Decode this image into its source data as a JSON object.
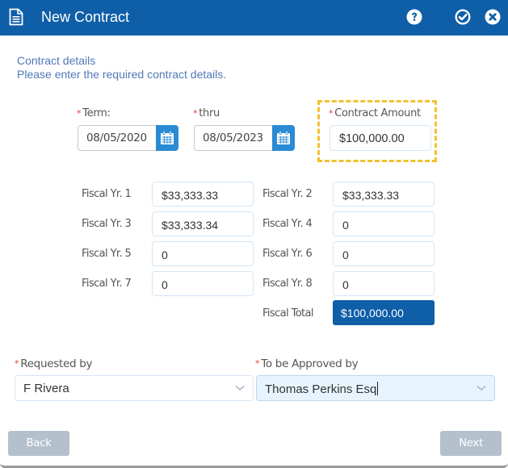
{
  "window": {
    "title": "New Contract",
    "icons": {
      "title": "document-icon",
      "help": "help-icon",
      "confirm": "check-circle-icon",
      "close": "close-circle-icon"
    }
  },
  "intro": {
    "heading": "Contract details",
    "subheading": "Please enter the required contract details."
  },
  "term": {
    "required_mark": "*",
    "start_label": "Term:",
    "start_value": "08/05/2020",
    "end_label": "thru",
    "end_value": "08/05/2023",
    "calendar_icon": "calendar-icon"
  },
  "contract_amount": {
    "required_mark": "*",
    "label": "Contract Amount",
    "value": "$100,000.00"
  },
  "fiscal_years": [
    {
      "label": "Fiscal Yr. 1",
      "value": "$33,333.33"
    },
    {
      "label": "Fiscal Yr. 2",
      "value": "$33,333.33"
    },
    {
      "label": "Fiscal Yr. 3",
      "value": "$33,333.34"
    },
    {
      "label": "Fiscal Yr. 4",
      "value": "0"
    },
    {
      "label": "Fiscal Yr. 5",
      "value": "0"
    },
    {
      "label": "Fiscal Yr. 6",
      "value": "0"
    },
    {
      "label": "Fiscal Yr. 7",
      "value": "0"
    },
    {
      "label": "Fiscal Yr. 8",
      "value": "0"
    }
  ],
  "fiscal_total": {
    "label": "Fiscal Total",
    "value": "$100,000.00"
  },
  "requested_by": {
    "required_mark": "*",
    "label": "Requested by",
    "value": "F Rivera"
  },
  "approved_by": {
    "required_mark": "*",
    "label": "To be Approved by",
    "value": "Thomas Perkins Esq"
  },
  "footer": {
    "back_label": "Back",
    "next_label": "Next"
  },
  "colors": {
    "brand": "#0f5ea8",
    "calendar_button": "#2b8ad4",
    "highlight": "#f2c12e",
    "required": "#e53935",
    "intro_text": "#4f79b8",
    "disabled_button": "#b4c0cc"
  }
}
